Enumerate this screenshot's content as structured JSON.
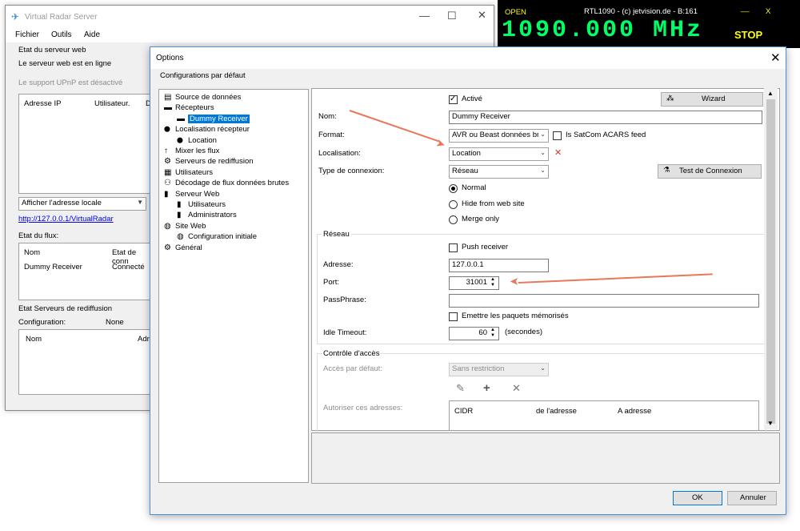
{
  "vrs": {
    "title": "Virtual Radar Server",
    "menu": [
      "Fichier",
      "Outils",
      "Aide"
    ],
    "web_status_header": "Etat du serveur web",
    "web_status": "Le serveur web est en ligne",
    "upnp": "Le support UPnP est désactivé",
    "grid1_cols": [
      "Adresse IP",
      "Utilisateur.",
      "D"
    ],
    "address_combo": "Afficher l'adresse locale",
    "link": "http://127.0.0.1/VirtualRadar",
    "feed_header": "Etat du flux:",
    "feed_cols": [
      "Nom",
      "Etat de conn"
    ],
    "feed_rows": [
      [
        "Dummy Receiver",
        "Connecté"
      ]
    ],
    "rebroadcast_header": "Etat Serveurs de rediffusion",
    "config_label": "Configuration:",
    "config_value": "None",
    "rebroadcast_cols": [
      "Nom",
      "Adre"
    ]
  },
  "rtl": {
    "open": "OPEN",
    "title": "RTL1090 - (c) jetvision.de - B:161",
    "minimize": "__",
    "close": "X",
    "frequency": "1090.000 MHz",
    "stop": "STOP"
  },
  "options": {
    "title": "Options",
    "close": "✕",
    "section": "Configurations par défaut",
    "tree": [
      {
        "label": "Source de données",
        "level": 0,
        "icon": "document-icon"
      },
      {
        "label": "Récepteurs",
        "level": 0,
        "icon": "receiver-icon"
      },
      {
        "label": "Dummy Receiver",
        "level": 1,
        "icon": "receiver-icon",
        "selected": true
      },
      {
        "label": "Localisation récepteur",
        "level": 0,
        "icon": "location-pin-icon"
      },
      {
        "label": "Location",
        "level": 1,
        "icon": "location-pin-icon"
      },
      {
        "label": "Mixer les flux",
        "level": 0,
        "icon": "merge-icon"
      },
      {
        "label": "Serveurs de rediffusion",
        "level": 0,
        "icon": "gears-icon"
      },
      {
        "label": "Utilisateurs",
        "level": 0,
        "icon": "users-icon"
      },
      {
        "label": "Décodage de flux données brutes",
        "level": 0,
        "icon": "decode-icon"
      },
      {
        "label": "Serveur Web",
        "level": 0,
        "icon": "server-icon"
      },
      {
        "label": "Utilisateurs",
        "level": 1,
        "icon": "server-icon"
      },
      {
        "label": "Administrators",
        "level": 1,
        "icon": "server-icon"
      },
      {
        "label": "Site Web",
        "level": 0,
        "icon": "globe-icon"
      },
      {
        "label": "Configuration initiale",
        "level": 1,
        "icon": "globe-icon"
      },
      {
        "label": "Général",
        "level": 0,
        "icon": "gear-icon"
      }
    ],
    "form": {
      "enabled": "Activé",
      "wizard": "Wizard",
      "name_label": "Nom:",
      "name_value": "Dummy Receiver",
      "format_label": "Format:",
      "format_value": "AVR ou Beast données bru",
      "satcom": "Is SatCom ACARS feed",
      "location_label": "Localisation:",
      "location_value": "Location",
      "conn_type_label": "Type de connexion:",
      "conn_type_value": "Réseau",
      "test_conn": "Test de Connexion",
      "radios": [
        "Normal",
        "Hide from web site",
        "Merge only"
      ],
      "network_group": "Réseau",
      "push_receiver": "Push receiver",
      "address_label": "Adresse:",
      "address_value": "127.0.0.1",
      "port_label": "Port:",
      "port_value": "31001",
      "passphrase_label": "PassPhrase:",
      "passphrase_value": "",
      "emit_label": "Emettre les paquets mémorisés",
      "idle_label": "Idle Timeout:",
      "idle_value": "60",
      "idle_unit": "(secondes)",
      "access_group": "Contrôle d'accès",
      "default_access_label": "Accès par défaut:",
      "default_access_value": "Sans restriction",
      "allow_label": "Autoriser ces adresses:",
      "cidr_cols": [
        "CIDR",
        "de l'adresse",
        "A adresse"
      ]
    },
    "ok": "OK",
    "cancel": "Annuler"
  },
  "colors": {
    "accent": "#0078d7",
    "arrow": "#e9775a",
    "rtl_text": "#ffff00",
    "rtl_freq": "#00ff66"
  }
}
